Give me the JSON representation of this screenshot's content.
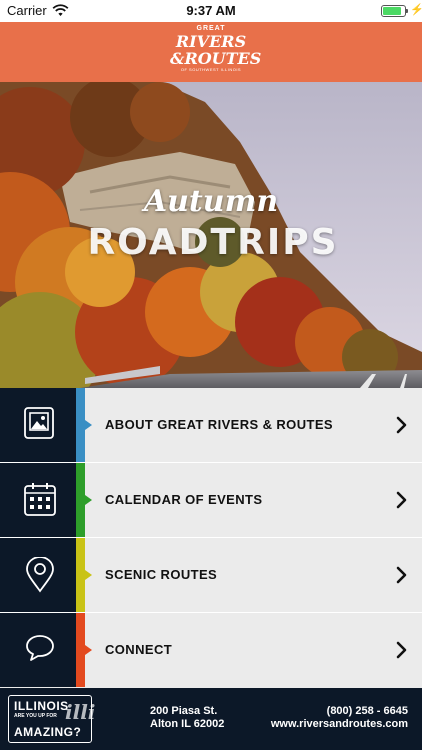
{
  "status_bar": {
    "carrier": "Carrier",
    "time": "9:37 AM",
    "battery_level": 0.85,
    "charging_symbol": "⚡"
  },
  "header": {
    "logo": {
      "top": "GREAT",
      "line1": "RIVERS",
      "line2": "&ROUTES",
      "tagline": "OF SOUTHWEST ILLINOIS"
    },
    "background_color": "#e8704a"
  },
  "hero": {
    "script_text": "Autumn",
    "block_text": "ROADTRIPS"
  },
  "menu": {
    "items": [
      {
        "label": "ABOUT GREAT RIVERS & ROUTES",
        "icon": "photo-icon",
        "accent": "#3a8fc4"
      },
      {
        "label": "CALENDAR OF EVENTS",
        "icon": "calendar-icon",
        "accent": "#2e9e2a"
      },
      {
        "label": "SCENIC ROUTES",
        "icon": "map-pin-icon",
        "accent": "#c9c316"
      },
      {
        "label": "CONNECT",
        "icon": "chat-bubble-icon",
        "accent": "#e34a1f"
      }
    ],
    "chevron_icon": "chevron-right-icon"
  },
  "footer": {
    "badge": {
      "title": "ILLINOIS",
      "subtitle": "ARE YOU UP FOR",
      "big": "AMAZING?",
      "script": "illi"
    },
    "address_line1": "200 Piasa St.",
    "address_line2": "Alton IL 62002",
    "phone": "(800) 258 - 6645",
    "website": "www.riversandroutes.com"
  }
}
